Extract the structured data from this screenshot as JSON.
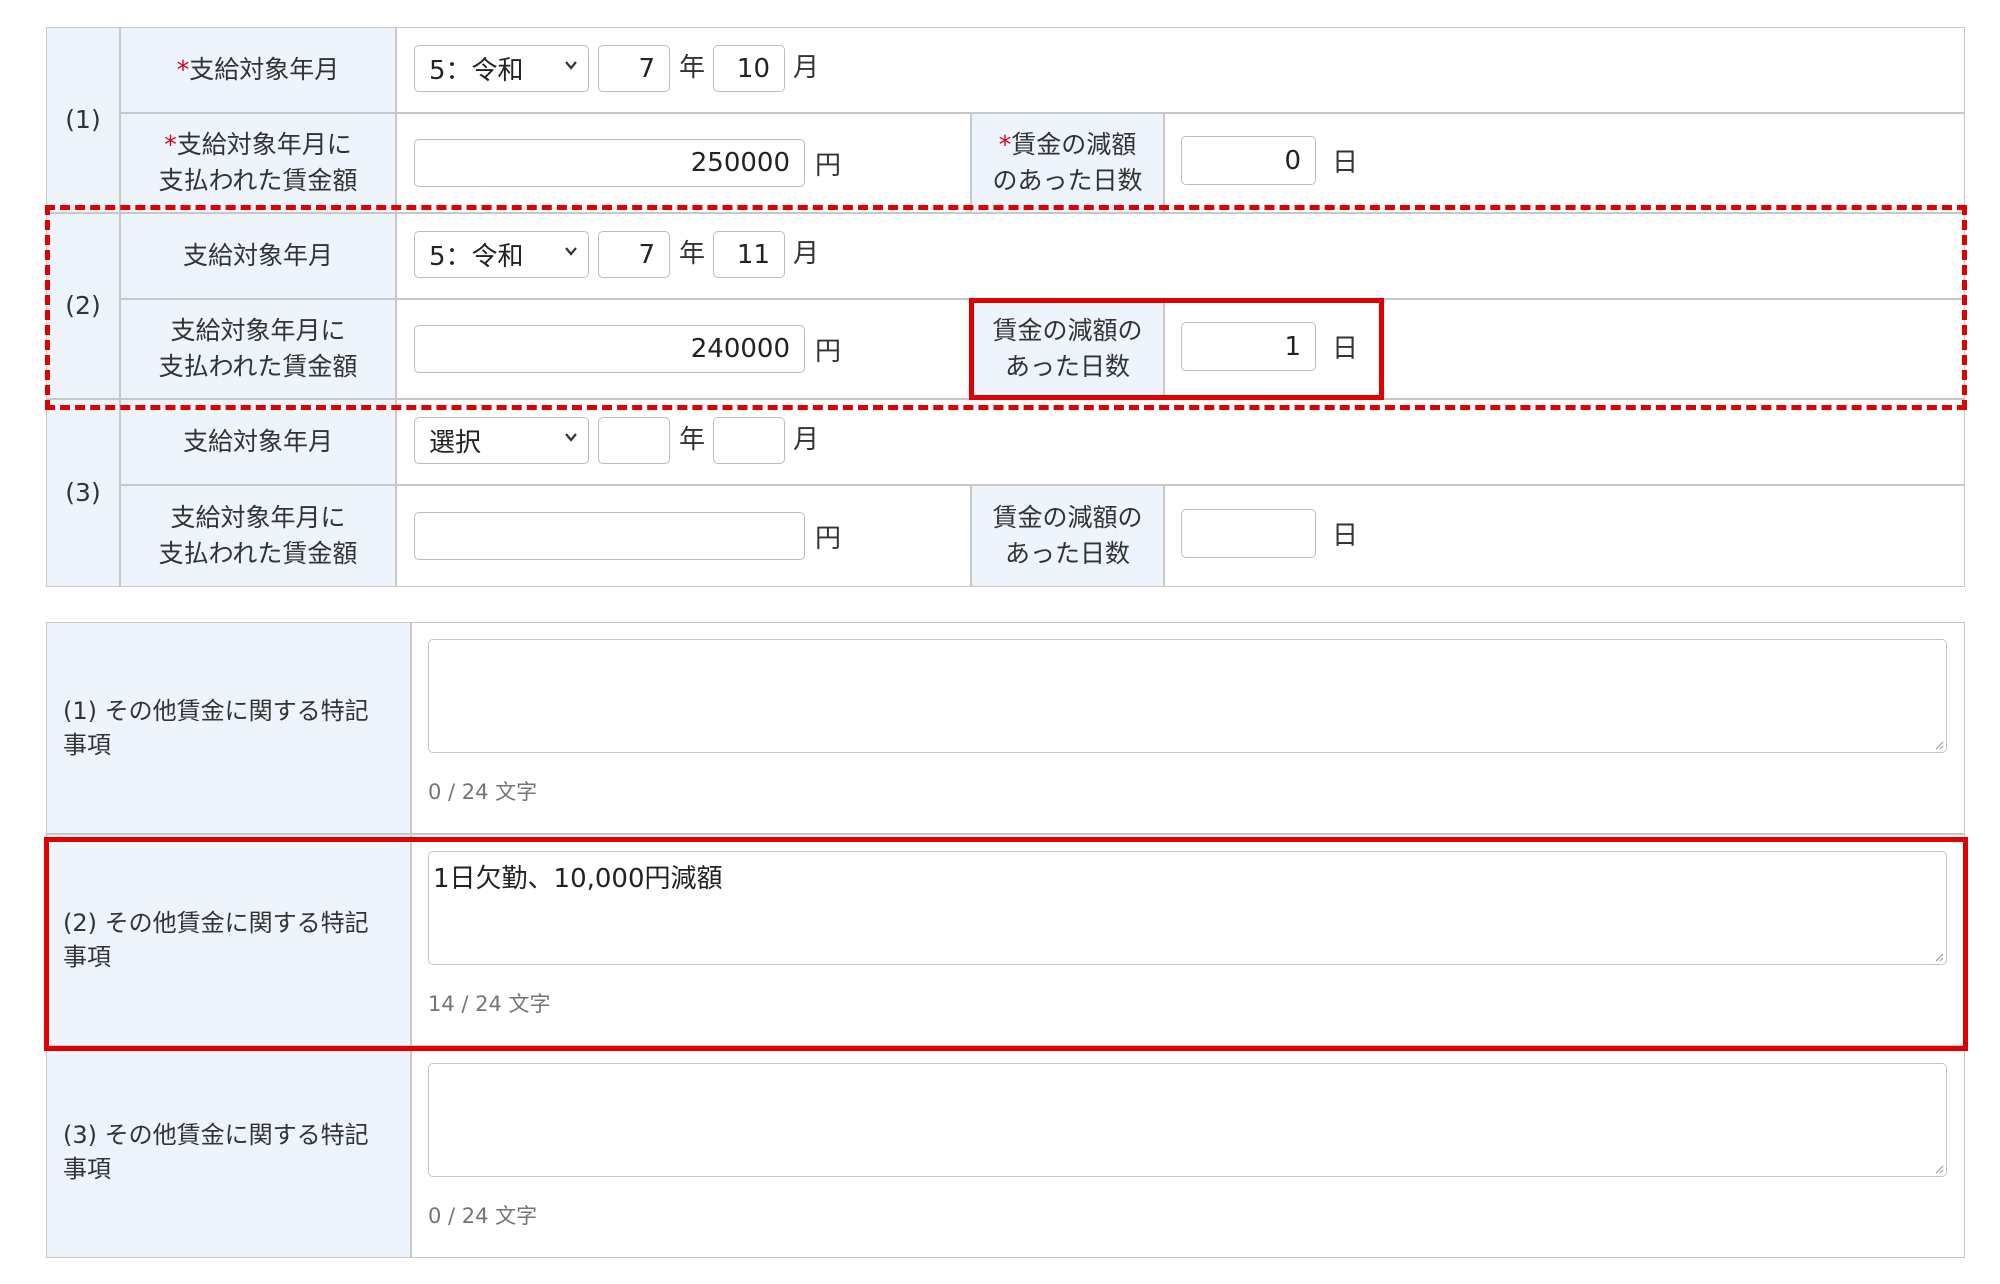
{
  "table1": {
    "rows": [
      {
        "index": "(1)",
        "year_month_label": "支給対象年月",
        "year_month_required": true,
        "era_selected": "5：令和",
        "year": "7",
        "year_unit": "年",
        "month": "10",
        "month_unit": "月",
        "wage_label_line1": "支給対象年月に",
        "wage_label_line2": "支払われた賃金額",
        "wage_required": true,
        "wage_value": "250000",
        "wage_unit": "円",
        "days_label_line1": "賃金の減額",
        "days_label_line2": "のあった日数",
        "days_required": true,
        "days_value": "0",
        "days_unit": "日"
      },
      {
        "index": "(2)",
        "year_month_label": "支給対象年月",
        "era_selected": "5：令和",
        "year": "7",
        "year_unit": "年",
        "month": "11",
        "month_unit": "月",
        "wage_label_line1": "支給対象年月に",
        "wage_label_line2": "支払われた賃金額",
        "wage_value": "240000",
        "wage_unit": "円",
        "days_label_line1": "賃金の減額の",
        "days_label_line2": "あった日数",
        "days_value": "1",
        "days_unit": "日"
      },
      {
        "index": "(3)",
        "year_month_label": "支給対象年月",
        "era_selected": "選択",
        "year": "",
        "year_unit": "年",
        "month": "",
        "month_unit": "月",
        "wage_label_line1": "支給対象年月に",
        "wage_label_line2": "支払われた賃金額",
        "wage_value": "",
        "wage_unit": "円",
        "days_label_line1": "賃金の減額の",
        "days_label_line2": "あった日数",
        "days_value": "",
        "days_unit": "日"
      }
    ]
  },
  "remarks": {
    "rows": [
      {
        "label_line1": "(1) その他賃金に関する特記",
        "label_line2": "事項",
        "value": "",
        "counter": "0 / 24 文字"
      },
      {
        "label_line1": "(2) その他賃金に関する特記",
        "label_line2": "事項",
        "value": "1日欠勤、10,000円減額",
        "counter": "14 / 24 文字"
      },
      {
        "label_line1": "(3) その他賃金に関する特記",
        "label_line2": "事項",
        "value": "",
        "counter": "0 / 24 文字"
      }
    ]
  },
  "colors": {
    "label_bg": "#edf4fb",
    "required_mark": "#d9001b",
    "highlight": "#e10000"
  },
  "icons": [
    "chevron-down-icon",
    "resize-grip-icon"
  ]
}
